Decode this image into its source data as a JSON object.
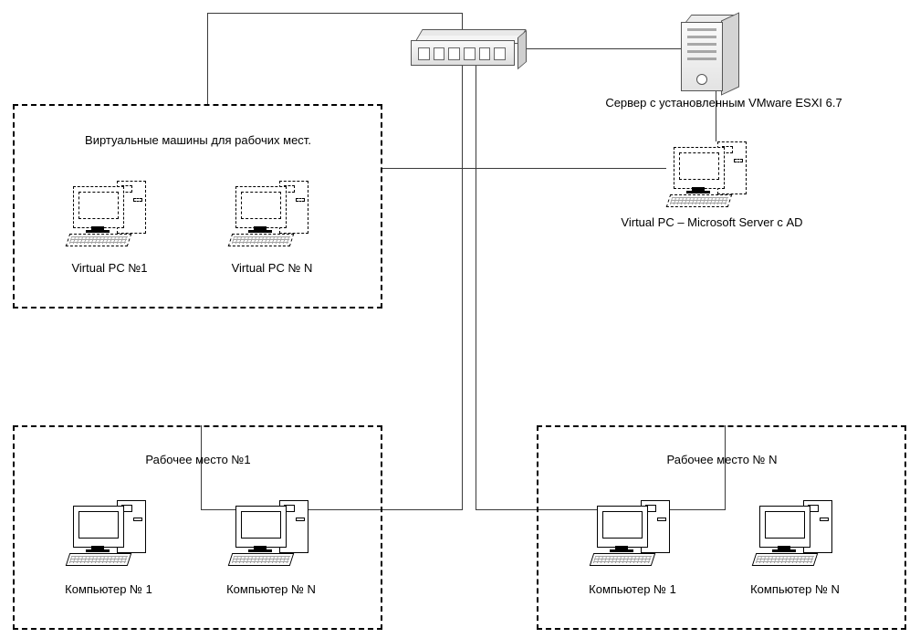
{
  "labels": {
    "server": "Сервер с установленным VMware ESXI 6.7",
    "virtual_ad": "Virtual PC – Microsoft Server с AD",
    "group_virtual_title": "Виртуальные машины для рабочих мест.",
    "vpc1": "Virtual PC №1",
    "vpcN": "Virtual PC № N",
    "workplace1_title": "Рабочее место №1",
    "workplaceN_title": "Рабочее место № N",
    "comp1": "Компьютер № 1",
    "compN": "Компьютер № N"
  },
  "icons": {
    "switch": "network-switch",
    "server": "server-tower",
    "pc": "desktop-workstation",
    "pc_virtual": "desktop-workstation-dashed"
  }
}
